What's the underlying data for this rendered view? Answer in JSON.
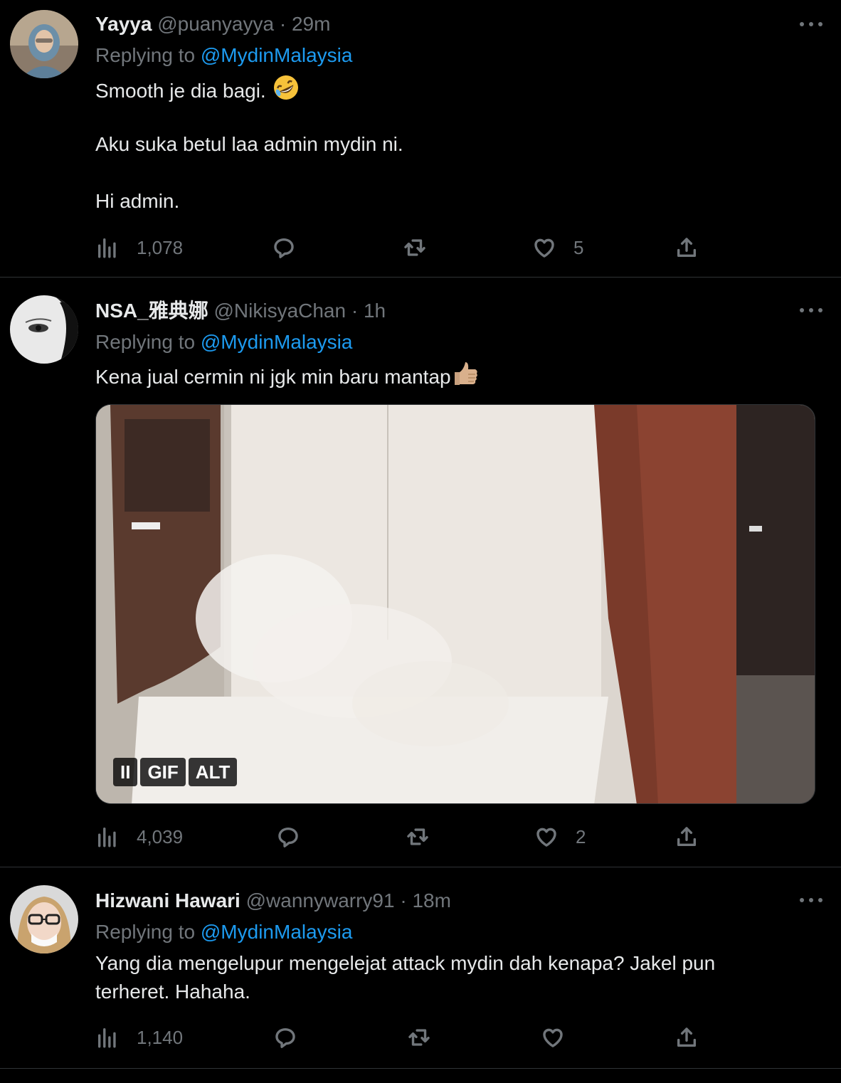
{
  "tweets": [
    {
      "display_name": "Yayya",
      "handle": "@puanyayya",
      "separator": "·",
      "time": "29m",
      "replying_label": "Replying to",
      "replying_to": "@MydinMalaysia",
      "lines": [
        "Smooth je dia bagi.",
        "",
        "Aku suka betul laa admin mydin ni.",
        "",
        "Hi admin."
      ],
      "emoji": "rolling-on-floor-laughing",
      "views": "1,078",
      "replies": "",
      "retweets": "",
      "likes": "5"
    },
    {
      "display_name": "NSA_雅典娜",
      "handle": "@NikisyaChan",
      "separator": "·",
      "time": "1h",
      "replying_label": "Replying to",
      "replying_to": "@MydinMalaysia",
      "text": "Kena jual cermin ni jgk min baru mantap",
      "emoji": "thumbs-up-medium-skin",
      "media_badges": [
        "II",
        "GIF",
        "ALT"
      ],
      "views": "4,039",
      "replies": "",
      "retweets": "",
      "likes": "2"
    },
    {
      "display_name": "Hizwani Hawari",
      "handle": "@wannywarry91",
      "separator": "·",
      "time": "18m",
      "replying_label": "Replying to",
      "replying_to": "@MydinMalaysia",
      "lines": [
        "Yang dia mengelupur mengelejat attack mydin dah kenapa? Jakel pun",
        "terheret. Hahaha."
      ],
      "views": "1,140",
      "replies": "",
      "retweets": "",
      "likes": ""
    }
  ],
  "colors": {
    "background": "#000000",
    "text": "#e7e9ea",
    "muted": "#71767b",
    "link": "#1d9bf0",
    "divider": "#2f3336"
  }
}
